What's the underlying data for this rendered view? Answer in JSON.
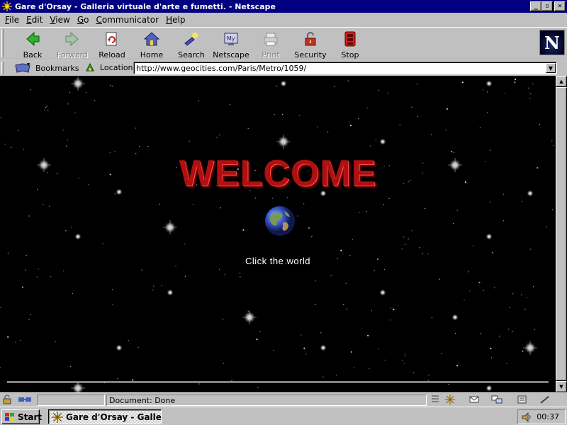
{
  "window": {
    "title": "Gare d'Orsay - Galleria virtuale d'arte e fumetti. - Netscape",
    "minimize": "_",
    "maximize": "▫",
    "close": "✕"
  },
  "menu": [
    {
      "label": "File",
      "u": "F",
      "rest": "ile"
    },
    {
      "label": "Edit",
      "u": "E",
      "rest": "dit"
    },
    {
      "label": "View",
      "u": "V",
      "rest": "iew"
    },
    {
      "label": "Go",
      "u": "G",
      "rest": "o"
    },
    {
      "label": "Communicator",
      "u": "C",
      "rest": "ommunicator"
    },
    {
      "label": "Help",
      "u": "H",
      "rest": "elp"
    }
  ],
  "toolbar": {
    "back": "Back",
    "forward": "Forward",
    "reload": "Reload",
    "home": "Home",
    "search": "Search",
    "netscape": "Netscape",
    "print": "Print",
    "security": "Security",
    "stop": "Stop",
    "logo": "N"
  },
  "location": {
    "bookmarks_label": "Bookmarks",
    "location_label": "Location:",
    "url": "http://www.geocities.com/Paris/Metro/1059/"
  },
  "page": {
    "welcome": "WELCOME",
    "click_world": "Click the world"
  },
  "status": {
    "text": "Document: Done"
  },
  "taskbar": {
    "start": "Start",
    "task": "Gare d'Orsay - Galleri...",
    "clock": "00:37"
  },
  "colors": {
    "titlebar": "#000080",
    "chrome": "#c0c0c0",
    "welcome_red": "#b01010",
    "content_bg": "#000000"
  }
}
